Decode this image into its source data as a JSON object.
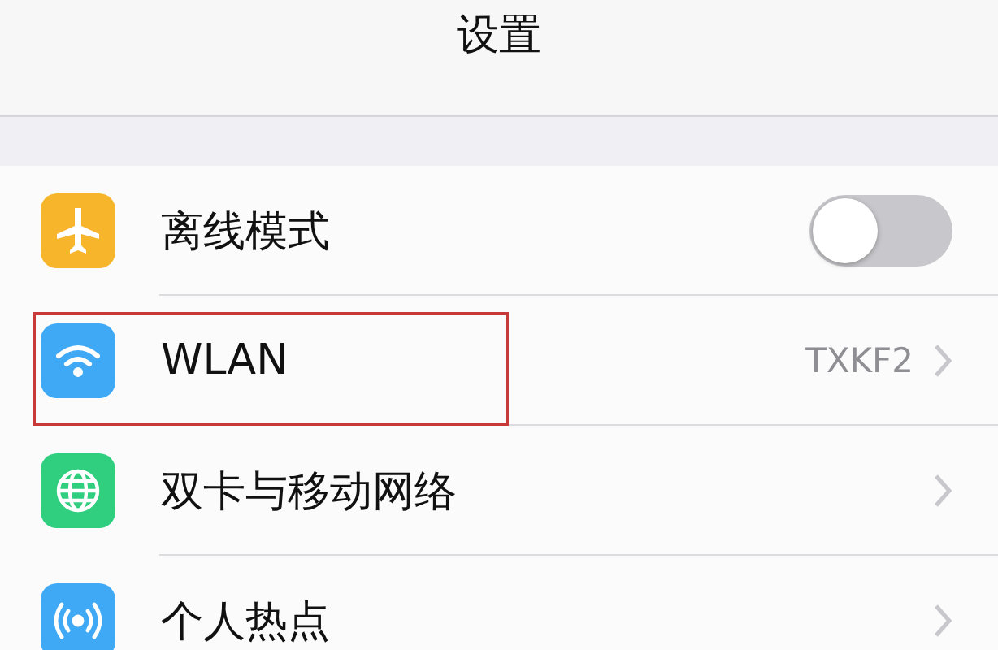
{
  "nav_bar": {
    "title": "设置"
  },
  "items": [
    {
      "label": "离线模式",
      "kind": "toggle",
      "on": false,
      "color": "#f7b52c",
      "highlighted": false
    },
    {
      "label": "WLAN",
      "kind": "detail",
      "value": "TXKF2",
      "color": "#3fa9f5",
      "highlighted": true
    },
    {
      "label": "双卡与移动网络",
      "kind": "detail",
      "color": "#2fcf7f",
      "highlighted": false
    },
    {
      "label": "个人热点",
      "kind": "detail",
      "color": "#3fa9f5",
      "highlighted": false
    }
  ]
}
